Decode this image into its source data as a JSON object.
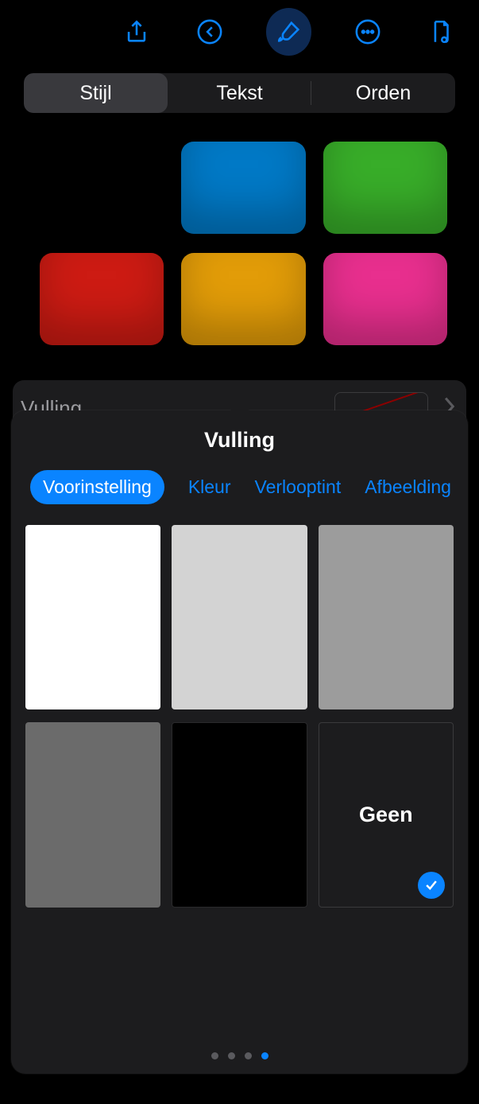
{
  "toolbar": {
    "share_icon": "share-icon",
    "undo_icon": "undo-icon",
    "brush_icon": "brush-icon",
    "more_icon": "more-icon",
    "doc_icon": "document-eye-icon"
  },
  "segment": {
    "items": [
      "Stijl",
      "Tekst",
      "Orden"
    ],
    "active_index": 0
  },
  "style_swatches": [
    "#000000",
    "#0079c6",
    "#38ad29",
    "#cd1b13",
    "#e29c08",
    "#e82f8e"
  ],
  "fill_row": {
    "label": "Vulling"
  },
  "popover": {
    "title": "Vulling",
    "tabs": {
      "preset": "Voorinstelling",
      "color": "Kleur",
      "gradient": "Verlooptint",
      "image": "Afbeelding",
      "active": "preset"
    },
    "presets": [
      {
        "type": "color",
        "value": "#ffffff"
      },
      {
        "type": "color",
        "value": "#d3d3d3"
      },
      {
        "type": "color",
        "value": "#9c9c9c"
      },
      {
        "type": "color",
        "value": "#6b6b6b"
      },
      {
        "type": "black"
      },
      {
        "type": "none",
        "label": "Geen",
        "selected": true
      }
    ],
    "page_dots": {
      "count": 4,
      "active_index": 3
    }
  }
}
